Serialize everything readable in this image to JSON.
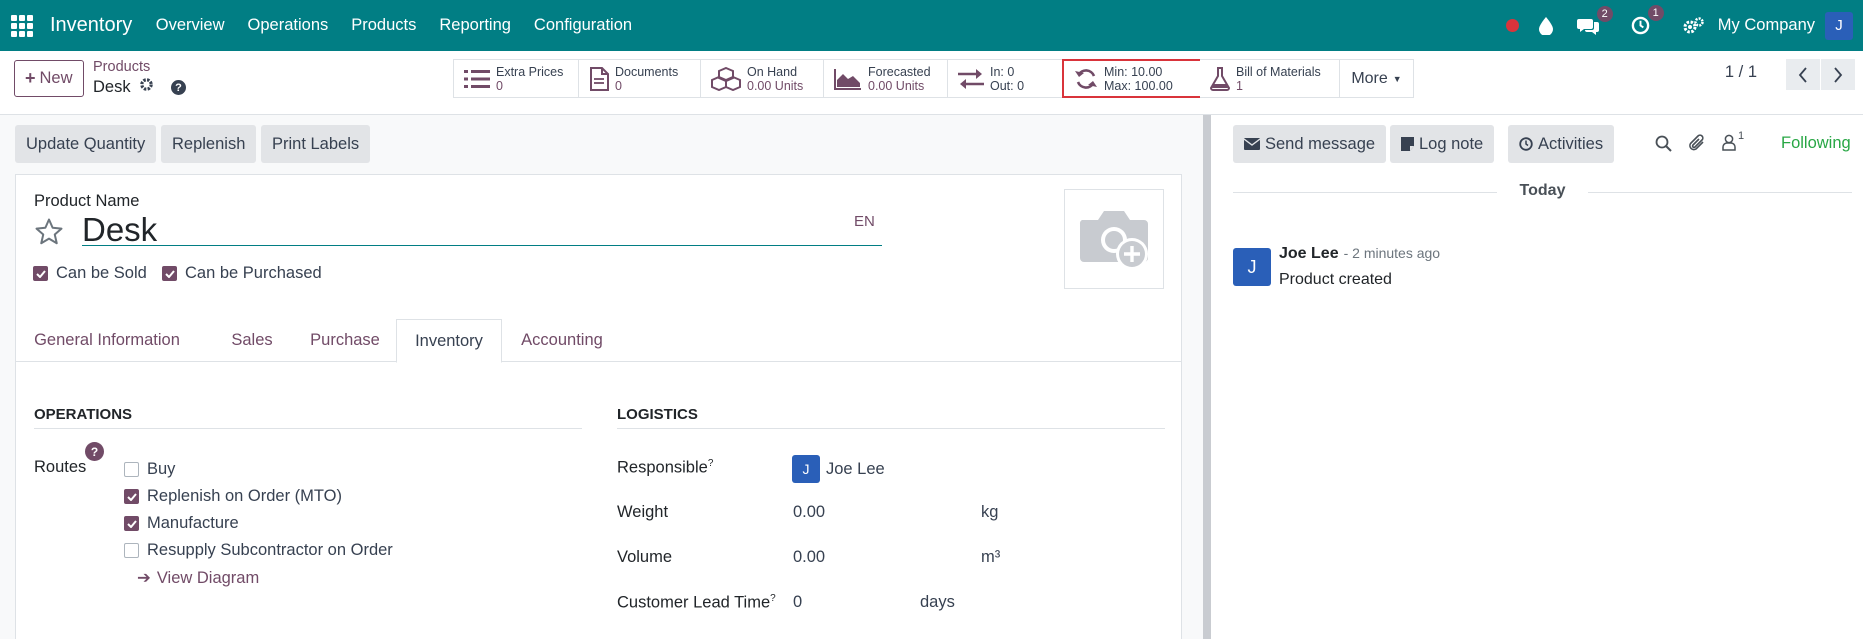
{
  "topbar": {
    "app_name": "Inventory",
    "menu": [
      "Overview",
      "Operations",
      "Products",
      "Reporting",
      "Configuration"
    ],
    "messages_count": "2",
    "activities_count": "1",
    "company": "My Company",
    "user_initial": "J"
  },
  "control_panel": {
    "new_label": "New",
    "breadcrumb_parent": "Products",
    "breadcrumb_current": "Desk",
    "help_label": "?",
    "smart_buttons": [
      {
        "title": "Extra Prices",
        "value": "0",
        "icon": "list-icon"
      },
      {
        "title": "Documents",
        "value": "0",
        "icon": "document-icon"
      },
      {
        "title": "On Hand",
        "value": "0.00 Units",
        "icon": "cubes-icon"
      },
      {
        "title": "Forecasted",
        "value": "0.00 Units",
        "icon": "area-chart-icon"
      },
      {
        "title": "In: 0",
        "value": "Out: 0",
        "icon": "exchange-icon"
      },
      {
        "title": "Min: 10.00",
        "value": "Max: 100.00",
        "icon": "refresh-icon"
      },
      {
        "title": "Bill of Materials",
        "value": "1",
        "icon": "flask-icon"
      }
    ],
    "more_label": "More",
    "pager": "1 / 1"
  },
  "actions": {
    "update_quantity": "Update Quantity",
    "replenish": "Replenish",
    "print_labels": "Print Labels"
  },
  "form": {
    "product_name_label": "Product Name",
    "product_name": "Desk",
    "lang": "EN",
    "can_be_sold": "Can be Sold",
    "can_be_purchased": "Can be Purchased",
    "tabs": [
      "General Information",
      "Sales",
      "Purchase",
      "Inventory",
      "Accounting"
    ],
    "active_tab": "Inventory",
    "operations_title": "OPERATIONS",
    "routes_label": "Routes",
    "routes_help": "?",
    "routes": [
      {
        "label": "Buy",
        "checked": false
      },
      {
        "label": "Replenish on Order (MTO)",
        "checked": true
      },
      {
        "label": "Manufacture",
        "checked": true
      },
      {
        "label": "Resupply Subcontractor on Order",
        "checked": false
      }
    ],
    "view_diagram": "View Diagram",
    "logistics_title": "LOGISTICS",
    "responsible_label": "Responsible",
    "responsible_initial": "J",
    "responsible": "Joe Lee",
    "weight_label": "Weight",
    "weight": "0.00",
    "weight_unit": "kg",
    "volume_label": "Volume",
    "volume": "0.00",
    "volume_unit": "m³",
    "lead_time_label": "Customer Lead Time",
    "lead_time": "0",
    "lead_time_unit": "days",
    "help_mark": "?"
  },
  "chatter": {
    "send_message": "Send message",
    "log_note": "Log note",
    "activities": "Activities",
    "followers_count": "1",
    "following": "Following",
    "date_separator": "Today",
    "author_initial": "J",
    "author": "Joe Lee",
    "time": "- 2 minutes ago",
    "message": "Product created"
  }
}
